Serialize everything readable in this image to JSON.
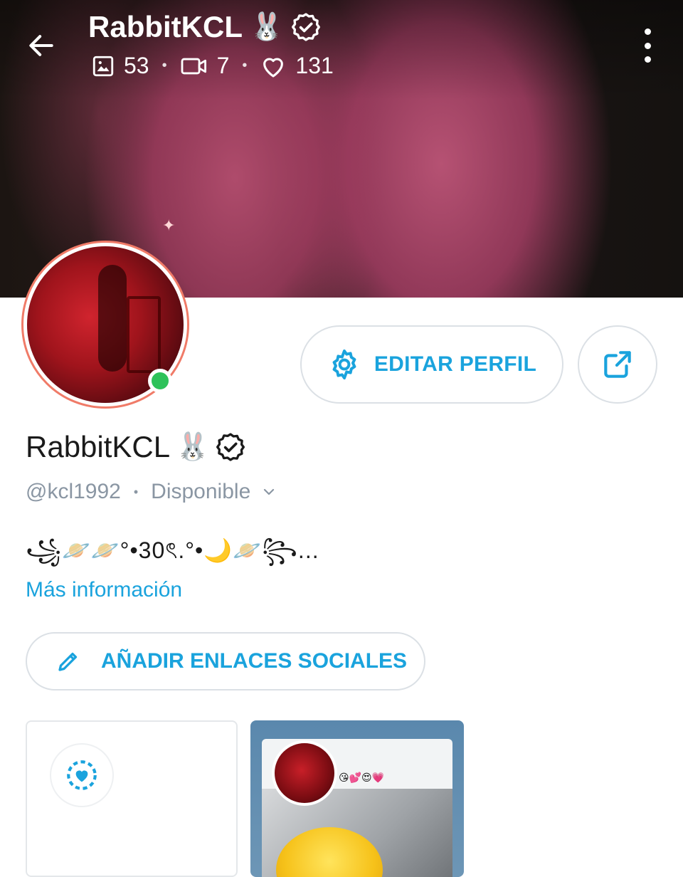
{
  "header": {
    "title": "RabbitKCL",
    "title_emoji": "🐰",
    "stats": {
      "photos": "53",
      "videos": "7",
      "likes": "131"
    }
  },
  "profile": {
    "display_name": "RabbitKCL",
    "name_emoji": "🐰",
    "username": "@kcl1992",
    "status": "Disponible",
    "bio": "꧁🪐🪐°•30ৎ.°•🌙🪐꧂...",
    "more_info": "Más información"
  },
  "actions": {
    "edit_profile": "EDITAR PERFIL",
    "add_social_links": "AÑADIR ENLACES SOCIALES"
  },
  "thumbnail": {
    "emojis": "😘💕😍💗"
  },
  "colors": {
    "accent": "#1aa3dd",
    "online": "#2ec25a",
    "avatar_ring": "#f07b68",
    "muted": "#8a96a3"
  },
  "icons": [
    "back-arrow-icon",
    "verified-badge-icon",
    "image-icon",
    "video-icon",
    "heart-icon",
    "more-vertical-icon",
    "gear-icon",
    "share-icon",
    "chevron-down-icon",
    "pencil-icon",
    "heart-circle-icon"
  ]
}
